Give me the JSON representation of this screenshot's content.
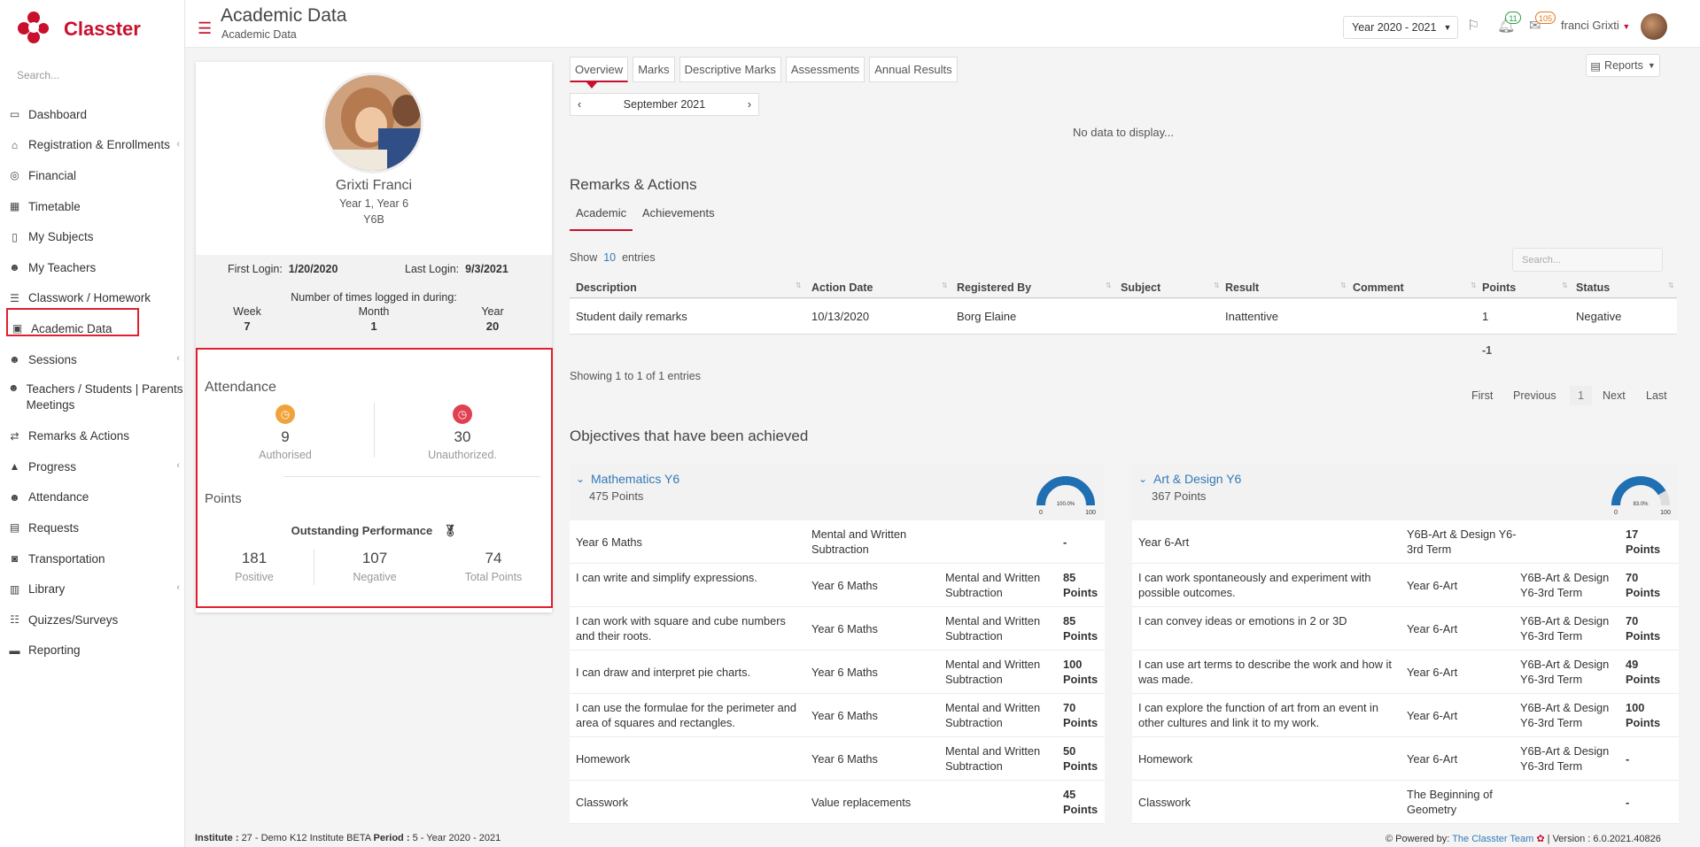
{
  "app": {
    "name": "Classter",
    "search_placeholder": "Search..."
  },
  "sidebar": {
    "items": [
      {
        "label": "Dashboard",
        "icon": "laptop-icon",
        "chev": false
      },
      {
        "label": "Registration & Enrollments",
        "icon": "institution-icon",
        "chev": true
      },
      {
        "label": "Financial",
        "icon": "coins-icon",
        "chev": false
      },
      {
        "label": "Timetable",
        "icon": "calendar-icon",
        "chev": false
      },
      {
        "label": "My Subjects",
        "icon": "book-icon",
        "chev": false
      },
      {
        "label": "My Teachers",
        "icon": "users-icon",
        "chev": false
      },
      {
        "label": "Classwork / Homework",
        "icon": "list-icon",
        "chev": false
      },
      {
        "label": "Academic Data",
        "icon": "id-card-icon",
        "chev": false
      },
      {
        "label": "Sessions",
        "icon": "user-cog-icon",
        "chev": true
      },
      {
        "label": "Teachers / Students | Parents Meetings",
        "icon": "user-clock-icon",
        "chev": true
      },
      {
        "label": "Remarks & Actions",
        "icon": "shuffle-icon",
        "chev": false
      },
      {
        "label": "Progress",
        "icon": "graduation-cap-icon",
        "chev": true
      },
      {
        "label": "Attendance",
        "icon": "user-x-icon",
        "chev": false
      },
      {
        "label": "Requests",
        "icon": "document-icon",
        "chev": false
      },
      {
        "label": "Transportation",
        "icon": "bus-icon",
        "chev": false
      },
      {
        "label": "Library",
        "icon": "library-icon",
        "chev": true
      },
      {
        "label": "Quizzes/Surveys",
        "icon": "checklist-icon",
        "chev": false
      },
      {
        "label": "Reporting",
        "icon": "printer-icon",
        "chev": false
      }
    ]
  },
  "header": {
    "title": "Academic Data",
    "subtitle": "Academic Data",
    "year": "Year 2020 - 2021",
    "notifications": "11",
    "messages": "105",
    "user": "franci Grixti"
  },
  "profile": {
    "name": "Grixti Franci",
    "year": "Year 1, Year 6",
    "class": "Y6B",
    "first_login_label": "First Login:",
    "first_login": "1/20/2020",
    "last_login_label": "Last Login:",
    "last_login": "9/3/2021",
    "times_label": "Number of times logged in during:",
    "week_label": "Week",
    "week": "7",
    "month_label": "Month",
    "month": "1",
    "year_label": "Year",
    "year_count": "20"
  },
  "attendance": {
    "title": "Attendance",
    "authorised": "9",
    "authorised_label": "Authorised",
    "unauthorized": "30",
    "unauthorized_label": "Unauthorized."
  },
  "points": {
    "title": "Points",
    "performance": "Outstanding Performance",
    "positive": "181",
    "positive_label": "Positive",
    "negative": "107",
    "negative_label": "Negative",
    "total": "74",
    "total_label": "Total Points"
  },
  "tabs": [
    "Overview",
    "Marks",
    "Descriptive Marks",
    "Assessments",
    "Annual Results"
  ],
  "month": "September 2021",
  "no_data": "No data to display...",
  "reports": "Reports",
  "remarks": {
    "title": "Remarks & Actions",
    "subtabs": [
      "Academic",
      "Achievements"
    ],
    "show": "Show",
    "entries_count": "10",
    "entries": "entries",
    "search_placeholder": "Search...",
    "columns": [
      "Description",
      "Action Date",
      "Registered By",
      "Subject",
      "Result",
      "Comment",
      "Points",
      "Status"
    ],
    "row": {
      "description": "Student daily remarks",
      "date": "10/13/2020",
      "registered_by": "Borg Elaine",
      "subject": "",
      "result": "Inattentive",
      "comment": "",
      "points": "1",
      "status": "Negative"
    },
    "total": "-1",
    "showing": "Showing 1 to 1 of 1 entries",
    "pager": [
      "First",
      "Previous",
      "1",
      "Next",
      "Last"
    ]
  },
  "objectives": {
    "title": "Objectives that have been achieved",
    "groups": [
      {
        "name": "Mathematics Y6",
        "points": "475 Points",
        "gauge_pct": 100,
        "gauge_label": "100.0%",
        "gauge_min": "0",
        "gauge_max": "100",
        "rows": [
          [
            "Year 6 Maths",
            "Mental and Written Subtraction",
            "",
            "-"
          ],
          [
            "I can write and simplify expressions.",
            "Year 6 Maths",
            "Mental and Written Subtraction",
            "85 Points"
          ],
          [
            "I can work with square and cube numbers and their roots.",
            "Year 6 Maths",
            "Mental and Written Subtraction",
            "85 Points"
          ],
          [
            "I can draw and interpret pie charts.",
            "Year 6 Maths",
            "Mental and Written Subtraction",
            "100 Points"
          ],
          [
            "I can use the formulae for the perimeter and area of squares and rectangles.",
            "Year 6 Maths",
            "Mental and Written Subtraction",
            "70 Points"
          ],
          [
            "Homework",
            "Year 6 Maths",
            "Mental and Written Subtraction",
            "50 Points"
          ],
          [
            "Classwork",
            "Value replacements",
            "",
            "45 Points"
          ]
        ]
      },
      {
        "name": "Art & Design Y6",
        "points": "367 Points",
        "gauge_pct": 83,
        "gauge_label": "83.0%",
        "gauge_min": "0",
        "gauge_max": "100",
        "rows": [
          [
            "Year 6-Art",
            "Y6B-Art & Design Y6-3rd Term",
            "",
            "17 Points"
          ],
          [
            "I can work spontaneously and experiment with possible outcomes.",
            "Year 6-Art",
            "Y6B-Art & Design Y6-3rd Term",
            "70 Points"
          ],
          [
            "I can convey ideas or emotions in 2 or 3D",
            "Year 6-Art",
            "Y6B-Art & Design Y6-3rd Term",
            "70 Points"
          ],
          [
            "I can use art terms to describe the work and how it was made.",
            "Year 6-Art",
            "Y6B-Art & Design Y6-3rd Term",
            "49 Points"
          ],
          [
            "I can explore the function of art from an event in other cultures and link it to my work.",
            "Year 6-Art",
            "Y6B-Art & Design Y6-3rd Term",
            "100 Points"
          ],
          [
            "Homework",
            "Year 6-Art",
            "Y6B-Art & Design Y6-3rd Term",
            "-"
          ],
          [
            "Classwork",
            "The Beginning of Geometry",
            "",
            "-"
          ]
        ]
      }
    ]
  },
  "footer": {
    "institute_label": "Institute :",
    "institute": "27 - Demo K12 Institute BETA",
    "period_label": "Period :",
    "period": "5 - Year 2020 - 2021",
    "powered": "Powered by:",
    "team": "The Classter Team",
    "version": "Version : 6.0.2021.40826"
  },
  "colors": {
    "brand": "#c8102e",
    "link": "#337ab7",
    "authorised": "#f0a33a",
    "unauthorized": "#e04050",
    "gauge": "#1f6fb2"
  }
}
